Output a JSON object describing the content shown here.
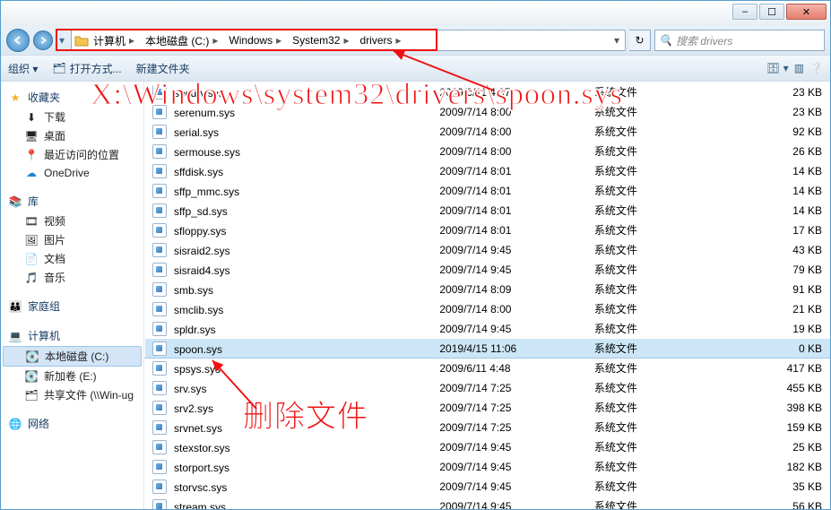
{
  "win_buttons": {
    "min": "–",
    "max": "☐",
    "close": "✕"
  },
  "address": {
    "crumbs": [
      "计算机",
      "本地磁盘 (C:)",
      "Windows",
      "System32",
      "drivers"
    ],
    "refresh": "↻",
    "search_placeholder": "搜索 drivers"
  },
  "toolbar": {
    "organize": "组织 ▾",
    "open_with": "打开方式...",
    "new_folder": "新建文件夹"
  },
  "nav": {
    "favorites": {
      "label": "收藏夹",
      "items": [
        "下载",
        "桌面",
        "最近访问的位置",
        "OneDrive"
      ]
    },
    "libraries": {
      "label": "库",
      "items": [
        "视频",
        "图片",
        "文档",
        "音乐"
      ]
    },
    "homegroup": {
      "label": "家庭组"
    },
    "computer": {
      "label": "计算机",
      "items": [
        "本地磁盘 (C:)",
        "新加卷 (E:)",
        "共享文件 (\\\\Win-ug"
      ]
    },
    "network": {
      "label": "网络"
    }
  },
  "col_type": "系统文件",
  "files": [
    {
      "n": "secdrv.sys",
      "d": "2009/6/11 4:37",
      "s": "23 KB"
    },
    {
      "n": "serenum.sys",
      "d": "2009/7/14 8:00",
      "s": "23 KB"
    },
    {
      "n": "serial.sys",
      "d": "2009/7/14 8:00",
      "s": "92 KB"
    },
    {
      "n": "sermouse.sys",
      "d": "2009/7/14 8:00",
      "s": "26 KB"
    },
    {
      "n": "sffdisk.sys",
      "d": "2009/7/14 8:01",
      "s": "14 KB"
    },
    {
      "n": "sffp_mmc.sys",
      "d": "2009/7/14 8:01",
      "s": "14 KB"
    },
    {
      "n": "sffp_sd.sys",
      "d": "2009/7/14 8:01",
      "s": "14 KB"
    },
    {
      "n": "sfloppy.sys",
      "d": "2009/7/14 8:01",
      "s": "17 KB"
    },
    {
      "n": "sisraid2.sys",
      "d": "2009/7/14 9:45",
      "s": "43 KB"
    },
    {
      "n": "sisraid4.sys",
      "d": "2009/7/14 9:45",
      "s": "79 KB"
    },
    {
      "n": "smb.sys",
      "d": "2009/7/14 8:09",
      "s": "91 KB"
    },
    {
      "n": "smclib.sys",
      "d": "2009/7/14 8:00",
      "s": "21 KB"
    },
    {
      "n": "spldr.sys",
      "d": "2009/7/14 9:45",
      "s": "19 KB"
    },
    {
      "n": "spoon.sys",
      "d": "2019/4/15 11:06",
      "s": "0 KB",
      "sel": true
    },
    {
      "n": "spsys.sys",
      "d": "2009/6/11 4:48",
      "s": "417 KB"
    },
    {
      "n": "srv.sys",
      "d": "2009/7/14 7:25",
      "s": "455 KB"
    },
    {
      "n": "srv2.sys",
      "d": "2009/7/14 7:25",
      "s": "398 KB"
    },
    {
      "n": "srvnet.sys",
      "d": "2009/7/14 7:25",
      "s": "159 KB"
    },
    {
      "n": "stexstor.sys",
      "d": "2009/7/14 9:45",
      "s": "25 KB"
    },
    {
      "n": "storport.sys",
      "d": "2009/7/14 9:45",
      "s": "182 KB"
    },
    {
      "n": "storvsc.sys",
      "d": "2009/7/14 9:45",
      "s": "35 KB"
    },
    {
      "n": "stream.sys",
      "d": "2009/7/14 9:45",
      "s": "56 KB"
    }
  ],
  "annotations": {
    "path": "X:\\Windows\\system32\\drivers\\spoon.sys",
    "delete": "删除文件"
  },
  "icons": {
    "star": "★",
    "dl": "⬇",
    "desk": "🖥",
    "recent": "📍",
    "onedrive": "☁",
    "lib": "📚",
    "vid": "🎞",
    "pic": "🖼",
    "doc": "📄",
    "mus": "🎵",
    "hg": "👪",
    "comp": "💻",
    "disk": "💽",
    "netloc": "🗂",
    "net": "🌐",
    "search": "🔍",
    "more": "⋯",
    "view": "☰",
    "help": "❔"
  }
}
